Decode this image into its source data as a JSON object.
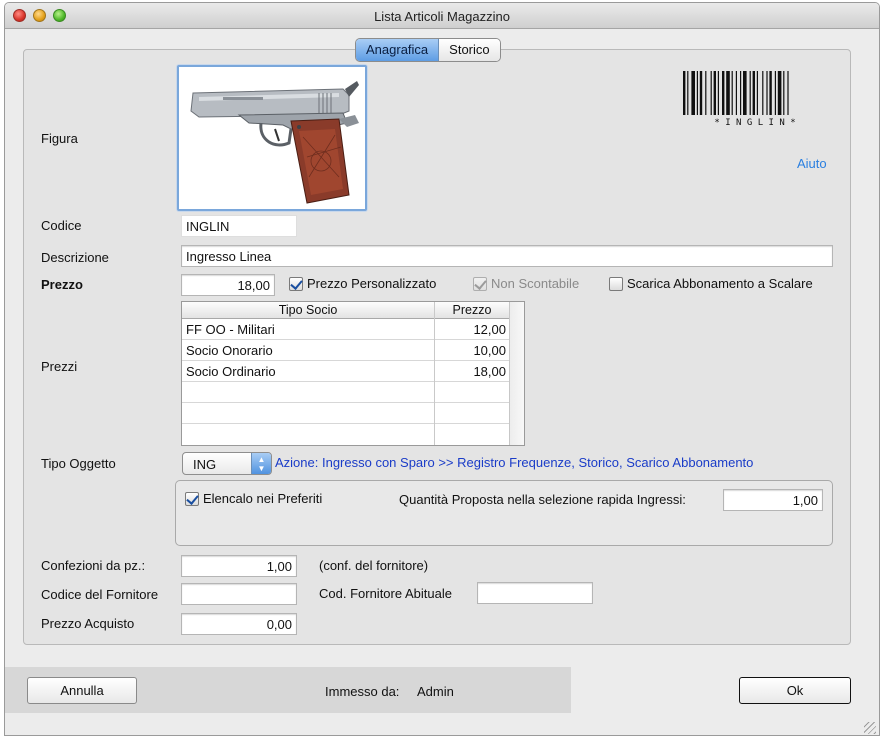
{
  "window": {
    "title": "Lista Articoli Magazzino"
  },
  "tabs": [
    {
      "label": "Anagrafica",
      "active": true
    },
    {
      "label": "Storico",
      "active": false
    }
  ],
  "form": {
    "figura_label": "Figura",
    "image_alt": "pistol-image",
    "barcode_text": "* I N G L I N *",
    "aiuto_label": "Aiuto",
    "codice_label": "Codice",
    "codice_value": "INGLIN",
    "descrizione_label": "Descrizione",
    "descrizione_value": "Ingresso Linea",
    "prezzo_label": "Prezzo",
    "prezzo_value": "18,00",
    "prezzo_personalizzato": {
      "label": "Prezzo Personalizzato",
      "checked": true
    },
    "non_scontabile": {
      "label": "Non Scontabile",
      "checked": true,
      "disabled": true
    },
    "scarica_abbonamento": {
      "label": "Scarica Abbonamento a Scalare",
      "checked": false
    },
    "prezzi_label": "Prezzi",
    "prezzi_table": {
      "columns": [
        "Tipo Socio",
        "Prezzo"
      ],
      "rows": [
        [
          "FF OO - Militari",
          "12,00"
        ],
        [
          "Socio Onorario",
          "10,00"
        ],
        [
          "Socio Ordinario",
          "18,00"
        ],
        [
          "",
          ""
        ],
        [
          "",
          ""
        ],
        [
          "",
          ""
        ]
      ]
    },
    "tipo_oggetto_label": "Tipo Oggetto",
    "tipo_oggetto_value": "ING",
    "azione_text": "Azione: Ingresso con Sparo >> Registro Frequenze, Storico, Scarico Abbonamento",
    "elencalo_preferiti": {
      "label": "Elencalo nei Preferiti",
      "checked": true
    },
    "quantita_label": "Quantità Proposta nella selezione rapida Ingressi:",
    "quantita_value": "1,00",
    "confezioni_label": "Confezioni da pz.:",
    "confezioni_value": "1,00",
    "conf_fornitore_note": "(conf. del fornitore)",
    "codice_fornitore_label": "Codice del Fornitore",
    "codice_fornitore_value": "",
    "cod_fornitore_abituale_label": "Cod. Fornitore Abituale",
    "cod_fornitore_abituale_value": "",
    "prezzo_acquisto_label": "Prezzo Acquisto",
    "prezzo_acquisto_value": "0,00"
  },
  "footer": {
    "annulla_label": "Annulla",
    "immesso_da_label": "Immesso da:",
    "immesso_da_value": "Admin",
    "ok_label": "Ok"
  },
  "colors": {
    "accent": "#5e9de4",
    "link": "#2a7fe0",
    "action": "#1a3cc8",
    "window_bg": "#ececec"
  }
}
